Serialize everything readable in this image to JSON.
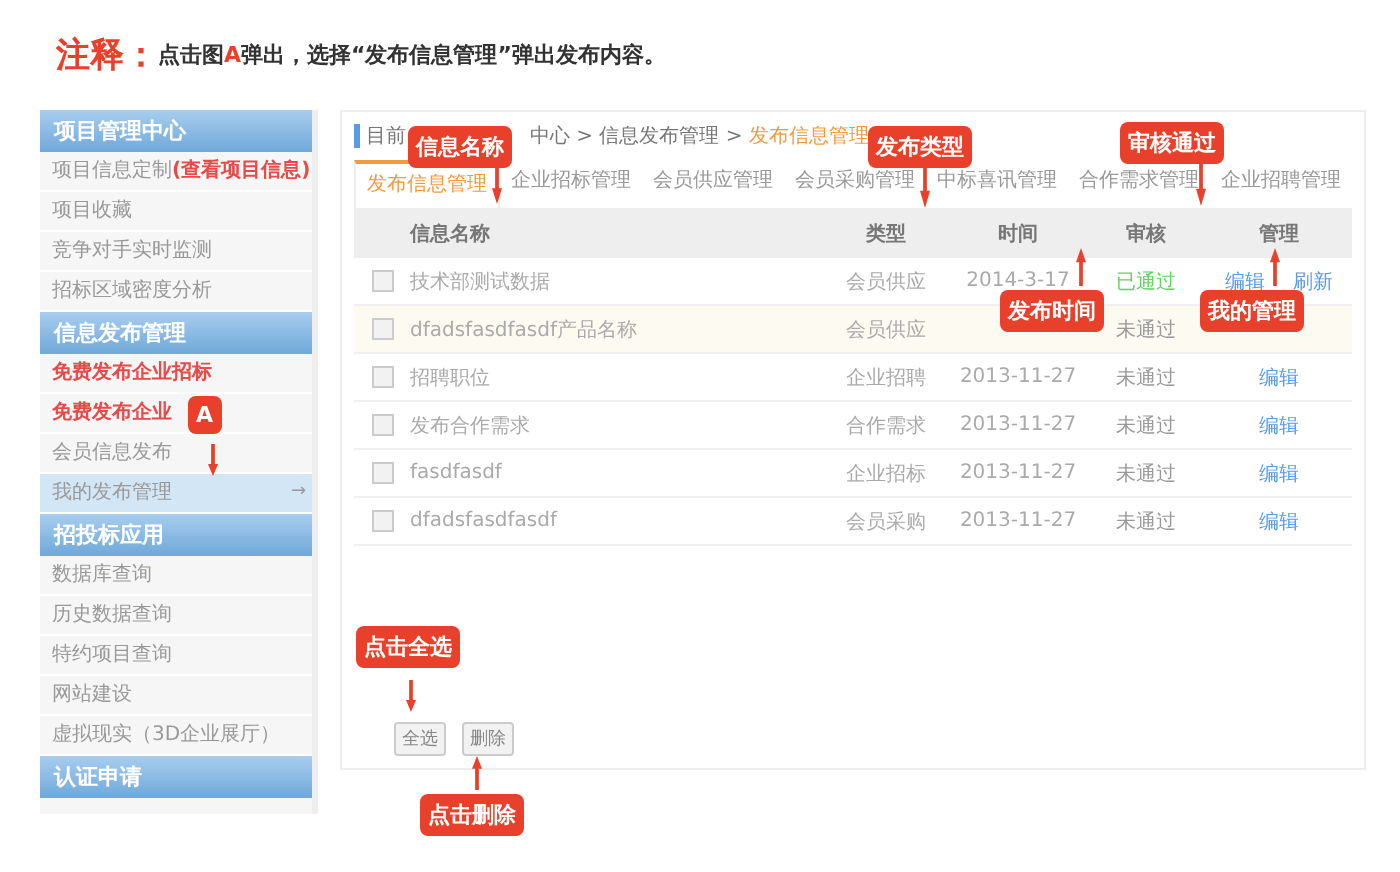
{
  "note": {
    "label": "注释：",
    "before": "点击图",
    "marker": "A",
    "after": "弹出，选择“发布信息管理”弹出发布内容。"
  },
  "sidebar": [
    {
      "title": "项目管理中心",
      "items": [
        {
          "label": "项目信息定制",
          "link": "(查看项目信息)",
          "kind": "normal",
          "selected": false
        },
        {
          "label": "项目收藏",
          "kind": "normal",
          "selected": false
        },
        {
          "label": "竞争对手实时监测",
          "kind": "normal",
          "selected": false
        },
        {
          "label": "招标区域密度分析",
          "kind": "normal",
          "selected": false
        }
      ]
    },
    {
      "title": "信息发布管理",
      "items": [
        {
          "label": "免费发布企业招标",
          "kind": "promo",
          "selected": false
        },
        {
          "label": "免费发布企业",
          "kind": "promo",
          "selected": false
        },
        {
          "label": "会员信息发布",
          "kind": "normal",
          "selected": false
        },
        {
          "label": "我的发布管理",
          "kind": "normal",
          "selected": true,
          "arrow": "→"
        }
      ]
    },
    {
      "title": "招投标应用",
      "items": [
        {
          "label": "数据库查询",
          "kind": "normal",
          "selected": false
        },
        {
          "label": "历史数据查询",
          "kind": "normal",
          "selected": false
        },
        {
          "label": "特约项目查询",
          "kind": "normal",
          "selected": false
        },
        {
          "label": "网站建设",
          "kind": "normal",
          "selected": false
        },
        {
          "label": "虚拟现实（3D企业展厅）",
          "kind": "normal",
          "selected": false
        }
      ]
    },
    {
      "title": "认证申请"
    }
  ],
  "breadcrumb": {
    "start": "目前",
    "rest": "中心 > 信息发布管理 >",
    "current": "发布信息管理"
  },
  "tabs": [
    {
      "label": "发布信息管理",
      "selected": true
    },
    {
      "label": "企业招标管理",
      "selected": false
    },
    {
      "label": "会员供应管理",
      "selected": false
    },
    {
      "label": "会员采购管理",
      "selected": false
    },
    {
      "label": "中标喜讯管理",
      "selected": false
    },
    {
      "label": "合作需求管理",
      "selected": false
    },
    {
      "label": "企业招聘管理",
      "selected": false
    }
  ],
  "table": {
    "columns": [
      "信息名称",
      "类型",
      "时间",
      "审核",
      "管理"
    ],
    "rows": [
      {
        "checked": false,
        "highlighted": false,
        "name": "技术部测试数据",
        "type": "会员供应",
        "time": "2014-3-17",
        "status": "已通过",
        "approved": true,
        "actions": [
          "编辑",
          "刷新"
        ]
      },
      {
        "checked": false,
        "highlighted": true,
        "name": "dfadsfasdfasdf产品名称",
        "type": "会员供应",
        "status": "未通过",
        "approved": false,
        "actions": []
      },
      {
        "checked": false,
        "highlighted": false,
        "name": "招聘职位",
        "type": "企业招聘",
        "time": "2013-11-27",
        "status": "未通过",
        "approved": false,
        "actions": [
          "编辑"
        ]
      },
      {
        "checked": false,
        "highlighted": false,
        "name": "发布合作需求",
        "type": "合作需求",
        "time": "2013-11-27",
        "status": "未通过",
        "approved": false,
        "actions": [
          "编辑"
        ]
      },
      {
        "checked": false,
        "highlighted": false,
        "name": "fasdfasdf",
        "type": "企业招标",
        "time": "2013-11-27",
        "status": "未通过",
        "approved": false,
        "actions": [
          "编辑"
        ]
      },
      {
        "checked": false,
        "highlighted": false,
        "name": "dfadsfasdfasdf",
        "type": "会员采购",
        "time": "2013-11-27",
        "status": "未通过",
        "approved": false,
        "actions": [
          "编辑"
        ]
      }
    ]
  },
  "buttons": [
    "全选",
    "删除"
  ],
  "callouts": [
    {
      "label": "信息名称"
    },
    {
      "label": "发布类型"
    },
    {
      "label": "审核通过"
    },
    {
      "label": "发布时间"
    },
    {
      "label": "我的管理"
    },
    {
      "label": "A"
    },
    {
      "label": "点击全选"
    },
    {
      "label": "点击删除"
    }
  ]
}
